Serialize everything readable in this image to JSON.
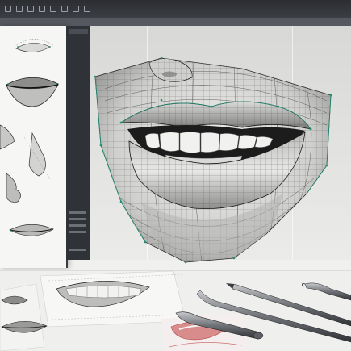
{
  "image": {
    "description": "",
    "subject": "lips-mouth-3d-wireframe-model",
    "colors": {
      "background": "#e9e9e7",
      "ui_dark": "#2b2d31",
      "wire": "#2c2c2c",
      "accent_teal": "#1f8f78",
      "skin_shadow": "#9a9a9a",
      "tool_metal": "#7c7f83",
      "red_sketch": "#c45a5a"
    }
  },
  "toolbar": {
    "icons": [
      "file-icon",
      "edit-icon",
      "view-icon",
      "tools-icon",
      "render-icon",
      "grid-icon",
      "settings-icon",
      "help-icon"
    ]
  }
}
